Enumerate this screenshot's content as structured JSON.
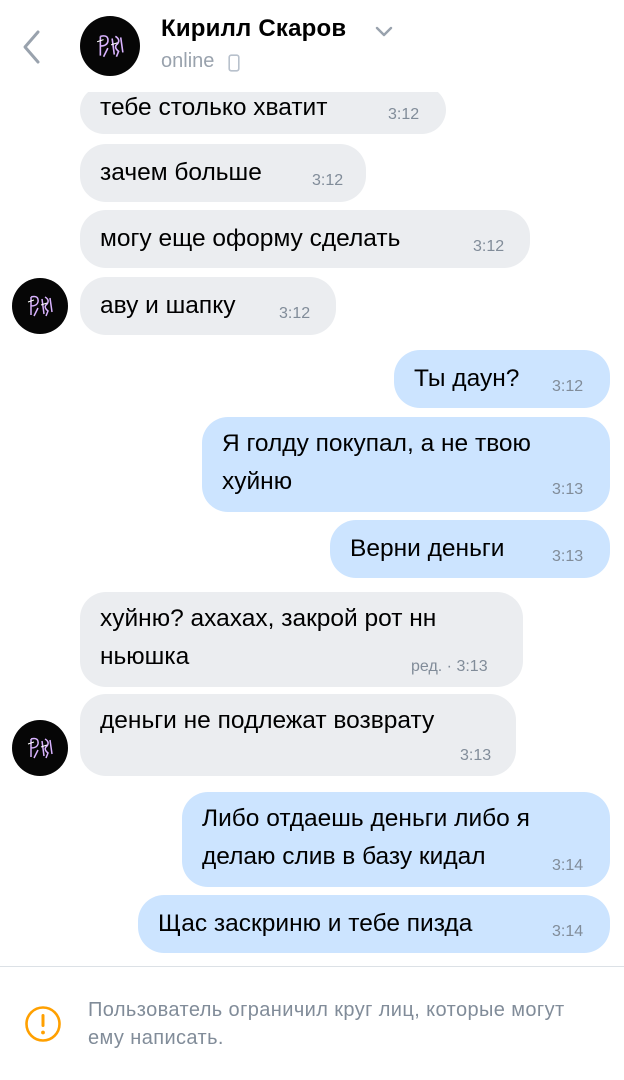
{
  "header": {
    "contact_name": "Кирилл Скаров",
    "status": "online",
    "back_icon": "chevron-left-icon",
    "menu_icon": "chevron-down-icon",
    "device_icon": "mobile-phone-icon"
  },
  "messages": [
    {
      "direction": "in",
      "text": "тебе столько хватит",
      "time": "3:12"
    },
    {
      "direction": "in",
      "text": "зачем больше",
      "time": "3:12"
    },
    {
      "direction": "in",
      "text": "могу еще оформу сделать",
      "time": "3:12"
    },
    {
      "direction": "in",
      "text": "аву и шапку",
      "time": "3:12"
    },
    {
      "direction": "out",
      "text": "Ты даун?",
      "time": "3:12"
    },
    {
      "direction": "out",
      "text": "Я голду покупал, а не твою\nхуйню",
      "time": "3:13"
    },
    {
      "direction": "out",
      "text": "Верни деньги",
      "time": "3:13"
    },
    {
      "direction": "in",
      "text": "хуйню? ахахах, закрой рот нн\nньюшка",
      "time": "ред. · 3:13"
    },
    {
      "direction": "in",
      "text": "деньги не подлежат возврату",
      "time": "3:13"
    },
    {
      "direction": "out",
      "text": "Либо отдаешь деньги либо я\nделаю слив в базу кидал",
      "time": "3:14"
    },
    {
      "direction": "out",
      "text": "Щас заскриню и тебе пизда",
      "time": "3:14"
    }
  ],
  "notice": {
    "text": "Пользователь ограничил круг лиц, которые могут ему написать.",
    "icon": "warning-circle-icon",
    "color": "#ffa000"
  },
  "colors": {
    "incoming_bubble": "#ebedf0",
    "outgoing_bubble": "#cce4ff",
    "secondary_text": "#818c99"
  }
}
